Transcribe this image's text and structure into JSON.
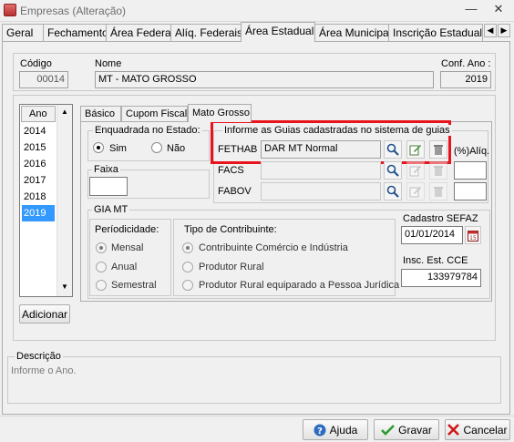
{
  "window": {
    "title": "Empresas (Alteração)"
  },
  "tabs": [
    {
      "label": "Geral"
    },
    {
      "label": "Fechamento"
    },
    {
      "label": "Área Federal"
    },
    {
      "label": "Alíq. Federais"
    },
    {
      "label": "Área Estadual",
      "active": true
    },
    {
      "label": "Área Municipal"
    },
    {
      "label": "Inscrição Estadual S"
    }
  ],
  "header": {
    "codigo_label": "Código",
    "codigo_value": "00014",
    "nome_label": "Nome",
    "nome_value": "MT - MATO GROSSO",
    "conf_ano_label": "Conf. Ano :",
    "conf_ano_value": "2019"
  },
  "year_list": {
    "header": "Ano",
    "items": [
      "2014",
      "2015",
      "2016",
      "2017",
      "2018",
      "2019"
    ],
    "selected": "2019",
    "add_button": "Adicionar"
  },
  "inner_tabs": [
    {
      "label": "Básico"
    },
    {
      "label": "Cupom Fiscal"
    },
    {
      "label": "Mato Grosso",
      "active": true
    }
  ],
  "enquadrada": {
    "legend": "Enquadrada no Estado:",
    "options": [
      {
        "label": "Sim",
        "checked": true
      },
      {
        "label": "Não",
        "checked": false
      }
    ]
  },
  "faixa": {
    "legend": "Faixa",
    "value": ""
  },
  "guias": {
    "legend": "Informe as Guias cadastradas no sistema de guias",
    "rows": [
      {
        "label": "FETHAB",
        "value": "DAR MT Normal",
        "enabled": true
      },
      {
        "label": "FACS",
        "value": "",
        "enabled": false
      },
      {
        "label": "FABOV",
        "value": "",
        "enabled": false
      }
    ],
    "aliq_label": "(%)Alíq.",
    "highlight_color": "#e8141c"
  },
  "gia": {
    "legend": "GIA MT",
    "periodicidade": {
      "legend": "Períodicidade:",
      "options": [
        {
          "label": "Mensal",
          "checked": true
        },
        {
          "label": "Anual",
          "checked": false
        },
        {
          "label": "Semestral",
          "checked": false
        }
      ]
    },
    "tipo": {
      "legend": "Tipo de Contribuinte:",
      "options": [
        {
          "label": "Contribuinte Comércio e Indústria",
          "checked": true
        },
        {
          "label": "Produtor Rural",
          "checked": false
        },
        {
          "label": "Produtor Rural equiparado a Pessoa Jurídica",
          "checked": false
        }
      ]
    },
    "cadastro_label": "Cadastro SEFAZ",
    "cadastro_value": "01/01/2014",
    "insc_label": "Insc. Est. CCE",
    "insc_value": "133979784"
  },
  "descricao": {
    "legend": "Descrição",
    "hint": "Informe o Ano."
  },
  "footer": {
    "ajuda": "Ajuda",
    "gravar": "Gravar",
    "cancelar": "Cancelar"
  },
  "colors": {
    "selection": "#3399ff",
    "highlight": "#e8141c"
  }
}
